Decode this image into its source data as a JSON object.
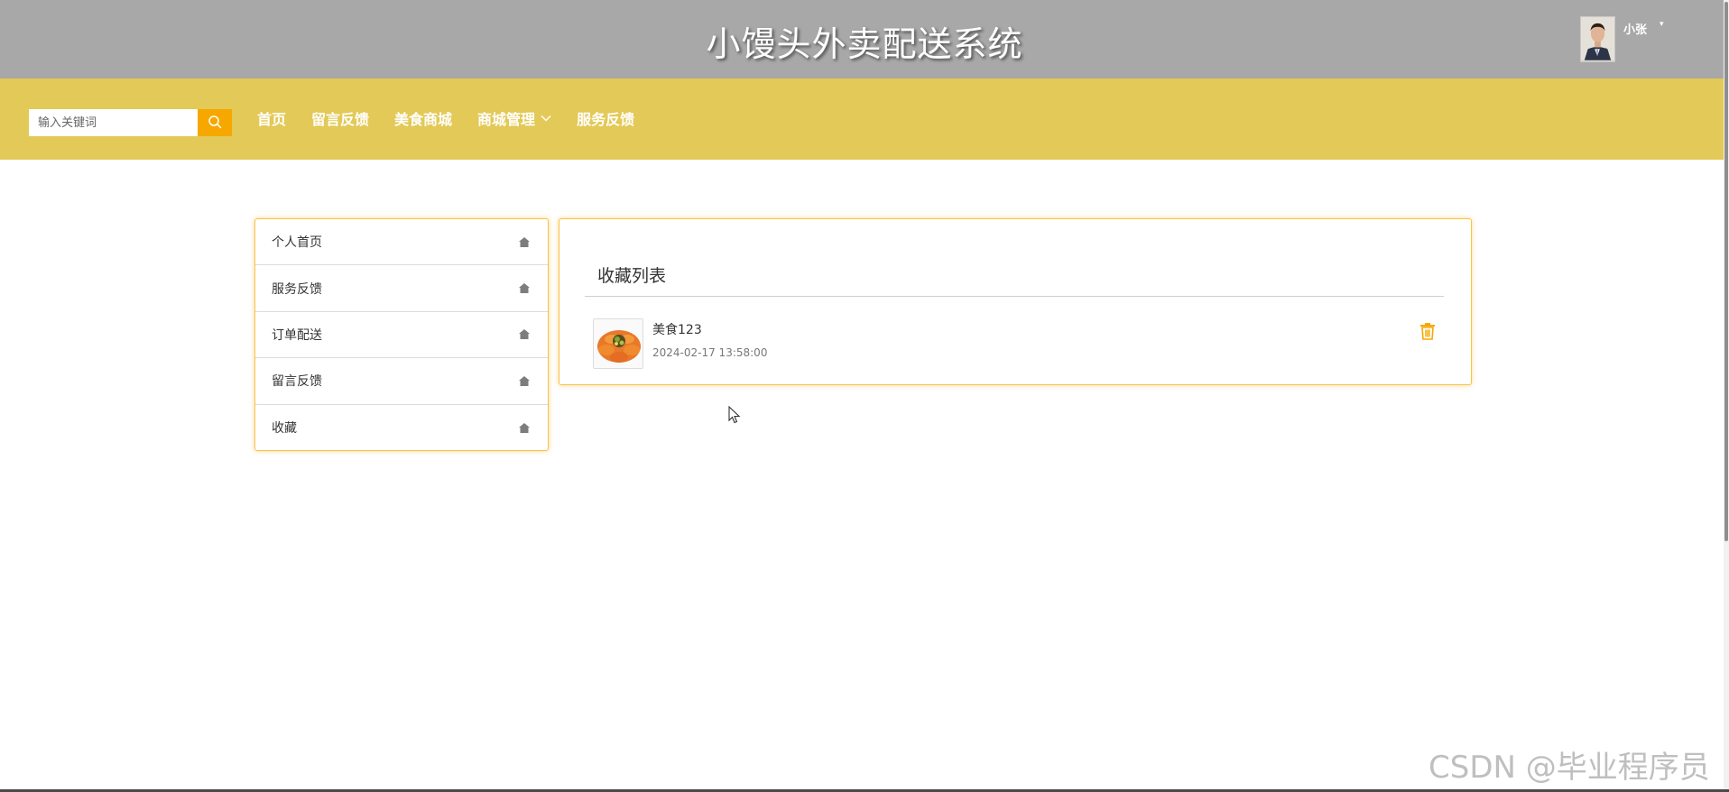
{
  "header": {
    "site_title": "小馒头外卖配送系统",
    "username": "小张",
    "caret": "▾"
  },
  "search": {
    "placeholder": "输入关键词"
  },
  "nav": {
    "items": [
      {
        "label": "首页"
      },
      {
        "label": "留言反馈"
      },
      {
        "label": "美食商城"
      },
      {
        "label": "商城管理",
        "has_dropdown": true
      },
      {
        "label": "服务反馈"
      }
    ]
  },
  "side_menu": {
    "items": [
      {
        "label": "个人首页",
        "icon": "home-icon"
      },
      {
        "label": "服务反馈",
        "icon": "home-icon"
      },
      {
        "label": "订单配送",
        "icon": "home-icon"
      },
      {
        "label": "留言反馈",
        "icon": "home-icon"
      },
      {
        "label": "收藏",
        "icon": "home-icon"
      }
    ]
  },
  "main": {
    "title": "收藏列表",
    "favorites": [
      {
        "name": "美食123",
        "time": "2024-02-17 13:58:00",
        "delete_icon": "trash-icon"
      }
    ]
  },
  "watermark": "CSDN @毕业程序员",
  "colors": {
    "header_bg": "#a8a8a8",
    "nav_bg": "#e3c957",
    "accent": "#f6a800",
    "panel_border": "#f6c34a"
  }
}
